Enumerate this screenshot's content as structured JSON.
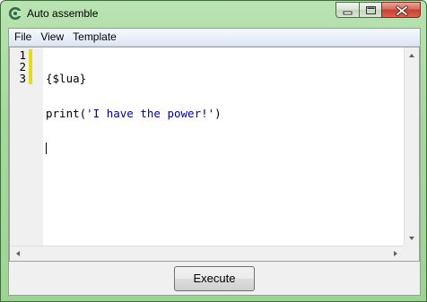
{
  "window": {
    "title": "Auto assemble",
    "icon": "cheat-engine-icon"
  },
  "menu": {
    "items": [
      {
        "label": "File"
      },
      {
        "label": "View"
      },
      {
        "label": "Template"
      }
    ]
  },
  "editor": {
    "line_numbers": [
      "1",
      "2",
      "3"
    ],
    "lines": [
      "{$lua}",
      "print('I have the power!')",
      ""
    ],
    "colors": {
      "text": "#000000",
      "string": "#0000a0",
      "change_marker": "#e5da1e",
      "gutter": "#f0f0f0"
    }
  },
  "bottom": {
    "execute_label": "Execute"
  }
}
